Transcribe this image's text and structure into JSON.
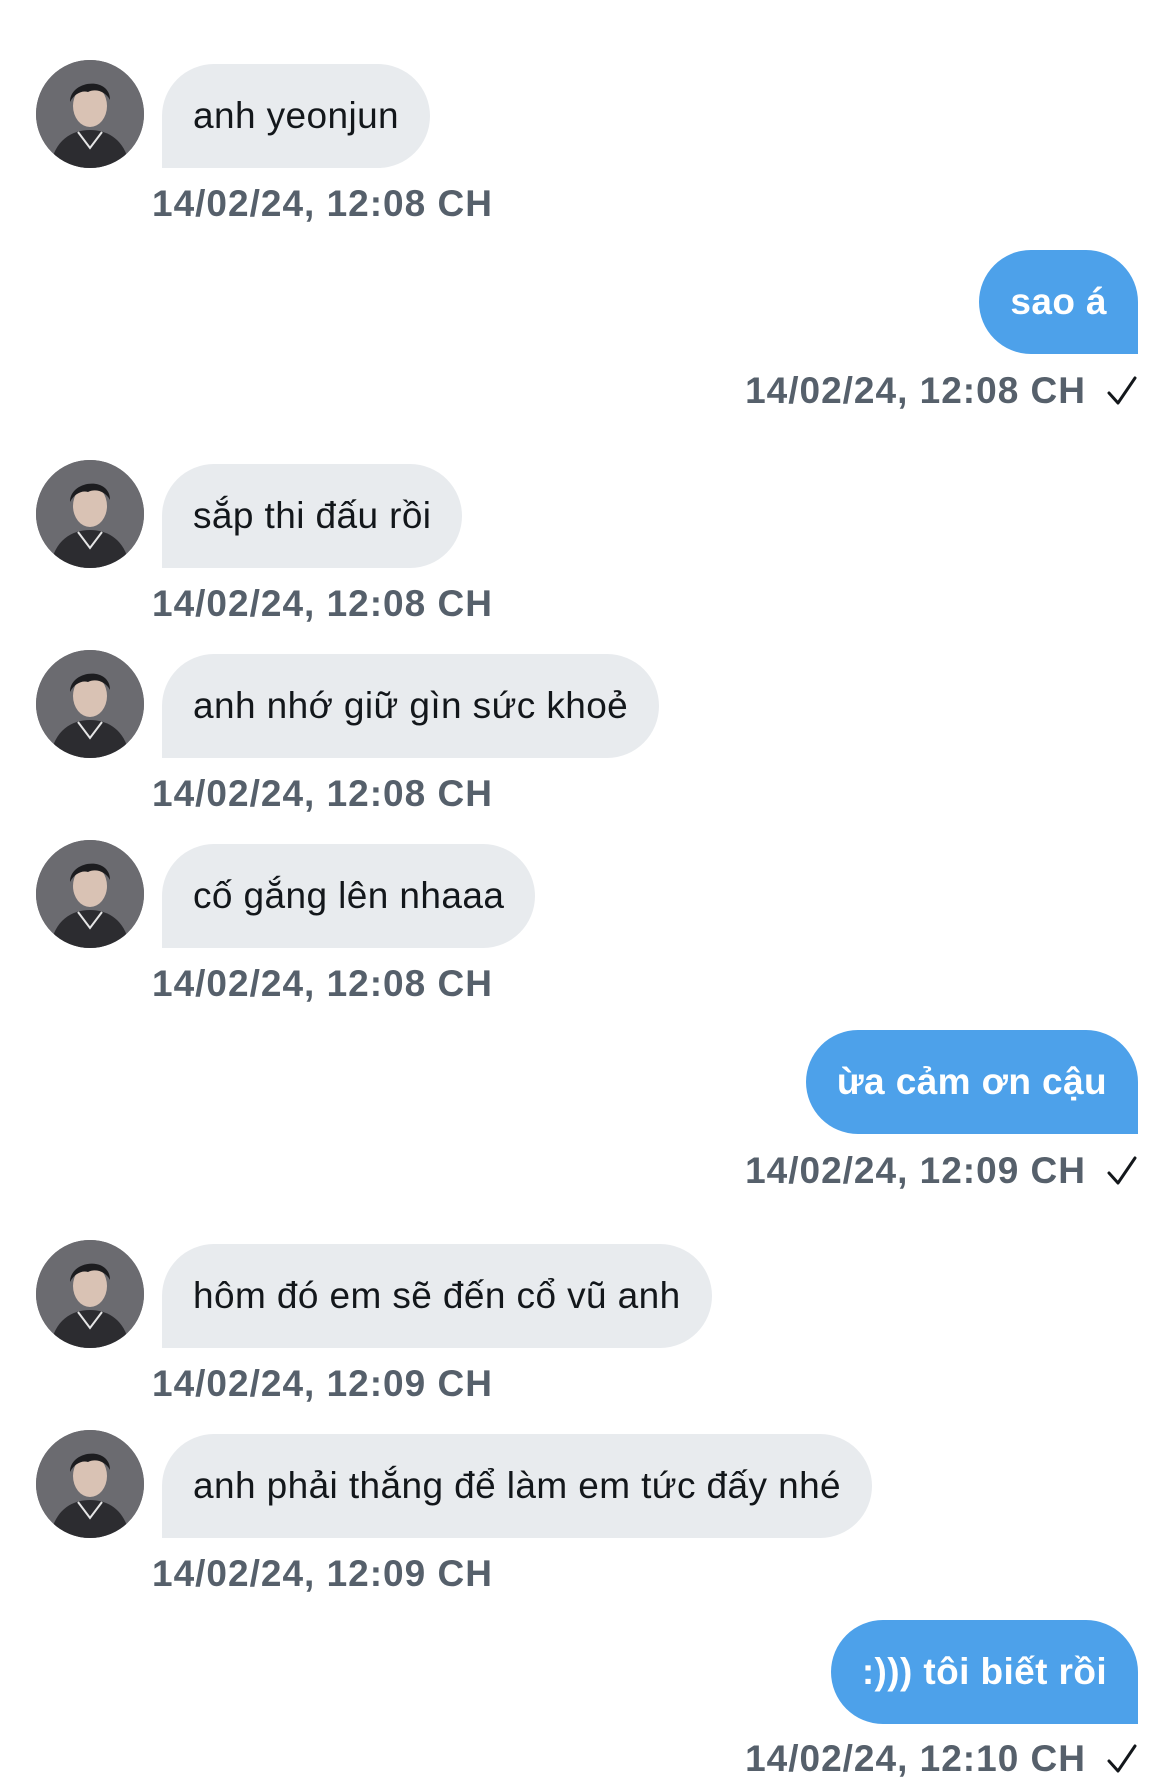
{
  "conversation": {
    "messages": [
      {
        "direction": "received",
        "text": "anh yeonjun",
        "timestamp": "14/02/24, 12:08 CH"
      },
      {
        "direction": "sent",
        "text": "sao á",
        "timestamp": "14/02/24, 12:08 CH",
        "status_icon": "checkmark-icon"
      },
      {
        "direction": "received",
        "text": "sắp thi đấu rồi",
        "timestamp": "14/02/24, 12:08 CH"
      },
      {
        "direction": "received",
        "text": "anh nhớ giữ gìn sức khoẻ",
        "timestamp": "14/02/24, 12:08 CH"
      },
      {
        "direction": "received",
        "text": "cố gắng lên nhaaa",
        "timestamp": "14/02/24, 12:08 CH"
      },
      {
        "direction": "sent",
        "text": "ừa cảm ơn cậu",
        "timestamp": "14/02/24, 12:09 CH",
        "status_icon": "checkmark-icon"
      },
      {
        "direction": "received",
        "text": "hôm đó em sẽ đến cổ vũ anh",
        "timestamp": "14/02/24, 12:09 CH"
      },
      {
        "direction": "received",
        "text": "anh phải thắng để làm em tức đấy nhé",
        "timestamp": "14/02/24, 12:09 CH"
      },
      {
        "direction": "sent",
        "text": ":))) tôi biết rồi",
        "timestamp": "14/02/24, 12:10 CH",
        "status_icon": "checkmark-icon"
      }
    ]
  },
  "colors": {
    "sent_bubble": "#4da1ea",
    "received_bubble": "#e8ebee",
    "timestamp_text": "#56606b",
    "background": "#ffffff"
  }
}
